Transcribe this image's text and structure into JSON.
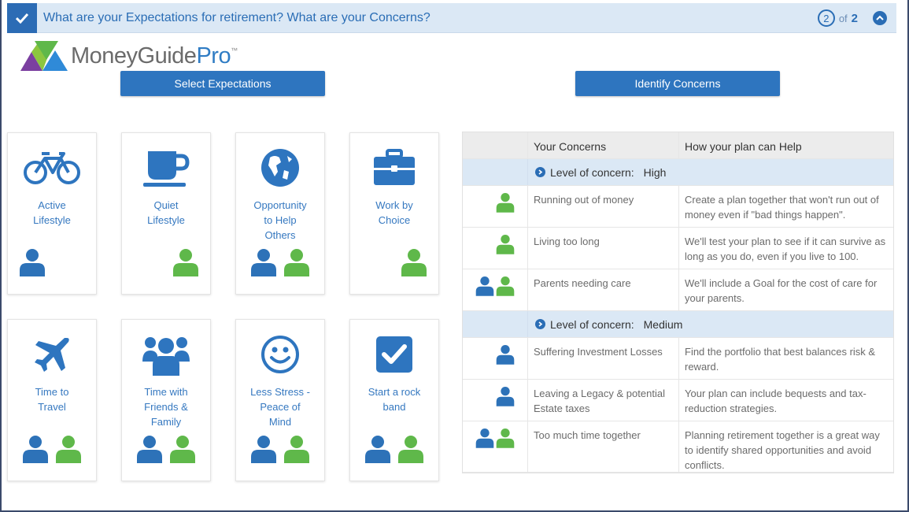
{
  "header": {
    "title": "What are your Expectations for retirement? What are your Concerns?",
    "page_current": "2",
    "page_of": "of",
    "page_total": "2"
  },
  "logo": {
    "text_money_guide": "MoneyGuide",
    "text_pro": "Pro",
    "trademark": "™"
  },
  "buttons": {
    "select_expectations": "Select Expectations",
    "identify_concerns": "Identify Concerns"
  },
  "colors": {
    "accent_blue": "#2e75bf",
    "person_blue": "#2d72b8",
    "person_green": "#5fb84a",
    "header_bg": "#dbe8f5"
  },
  "expectations": [
    {
      "label": "Active\nLifestyle",
      "icon": "bicycle-icon",
      "people": [
        "blue"
      ]
    },
    {
      "label": "Quiet\nLifestyle",
      "icon": "coffee-cup-icon",
      "people": [
        "green"
      ]
    },
    {
      "label": "Opportunity\nto Help\nOthers",
      "icon": "globe-icon",
      "people": [
        "blue",
        "green"
      ]
    },
    {
      "label": "Work by\nChoice",
      "icon": "briefcase-icon",
      "people": [
        "green"
      ]
    },
    {
      "label": "Time to\nTravel",
      "icon": "airplane-icon",
      "people": [
        "blue",
        "green"
      ]
    },
    {
      "label": "Time with\nFriends &\nFamily",
      "icon": "group-icon",
      "people": [
        "blue",
        "green"
      ]
    },
    {
      "label": "Less Stress -\nPeace of\nMind",
      "icon": "smiley-icon",
      "people": [
        "blue",
        "green"
      ]
    },
    {
      "label": "Start a rock\nband",
      "icon": "checkbox-icon",
      "people": [
        "blue",
        "green"
      ]
    }
  ],
  "concerns_table": {
    "headers": {
      "concerns": "Your Concerns",
      "help": "How your plan can Help"
    },
    "level_prefix": "Level of concern:",
    "groups": [
      {
        "level": "High",
        "rows": [
          {
            "people": [
              "green"
            ],
            "concern": "Running out of money",
            "help": "Create a plan together that won't run out of money even if \"bad things happen\"."
          },
          {
            "people": [
              "green"
            ],
            "concern": "Living too long",
            "help": "We'll test your plan to see if it can survive as long as you do, even if you live to 100."
          },
          {
            "people": [
              "blue",
              "green"
            ],
            "concern": "Parents needing care",
            "help": "We'll include a Goal for the cost of care for your parents."
          }
        ]
      },
      {
        "level": "Medium",
        "rows": [
          {
            "people": [
              "blue"
            ],
            "concern": "Suffering Investment Losses",
            "help": "Find the portfolio that best balances risk & reward."
          },
          {
            "people": [
              "blue"
            ],
            "concern": "Leaving a Legacy & potential Estate taxes",
            "help": "Your plan can include bequests and tax-reduction strategies."
          },
          {
            "people": [
              "blue",
              "green"
            ],
            "concern": "Too much time together",
            "help": "Planning retirement together is a great way to identify shared opportunities and avoid conflicts."
          }
        ]
      }
    ]
  }
}
